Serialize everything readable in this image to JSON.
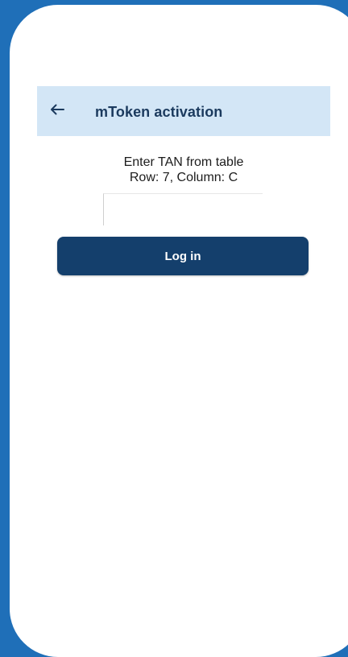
{
  "colors": {
    "background": "#1f6fb8",
    "screen": "#ffffff",
    "app_bar": "#d3e6f6",
    "title_text": "#1b3a5e",
    "primary_button": "#143f6c"
  },
  "app_bar": {
    "back_icon": "arrow-left-icon",
    "title": "mToken activation"
  },
  "instruction": {
    "line1": "Enter TAN from table",
    "line2": "Row: 7, Column: C"
  },
  "tan_input": {
    "value": "",
    "placeholder": ""
  },
  "login_button": {
    "label": "Log in"
  }
}
